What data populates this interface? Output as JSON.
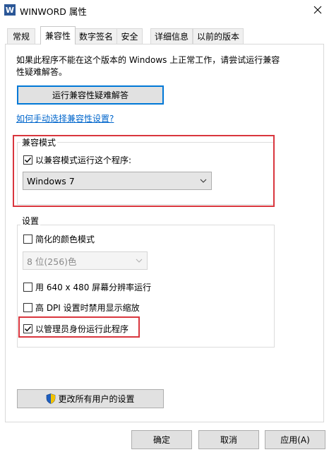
{
  "window": {
    "app_icon_letter": "W",
    "title": "WINWORD 属性"
  },
  "tabs": [
    {
      "label": "常规"
    },
    {
      "label": "兼容性"
    },
    {
      "label": "数字签名"
    },
    {
      "label": "安全"
    },
    {
      "label": "详细信息"
    },
    {
      "label": "以前的版本"
    }
  ],
  "active_tab": "兼容性",
  "intro": {
    "text": "如果此程序不能在这个版本的 Windows 上正常工作，请尝试运行兼容性疑难解答。"
  },
  "troubleshoot_button": {
    "label": "运行兼容性疑难解答"
  },
  "manual_link": {
    "label": "如何手动选择兼容性设置?"
  },
  "compat_mode": {
    "group_label": "兼容模式",
    "checkbox_label": "以兼容模式运行这个程序:",
    "checked": true,
    "os_select": {
      "value": "Windows 7"
    }
  },
  "settings": {
    "group_label": "设置",
    "reduced_color": {
      "label": "简化的颜色模式",
      "checked": false
    },
    "color_select": {
      "value": "8 位(256)色",
      "disabled": true
    },
    "res_640": {
      "label": "用 640 x 480 屏幕分辨率运行",
      "checked": false
    },
    "high_dpi": {
      "label": "高 DPI 设置时禁用显示缩放",
      "checked": false
    },
    "run_as_admin": {
      "label": "以管理员身份运行此程序",
      "checked": true
    }
  },
  "all_users_button": {
    "label": "更改所有用户的设置",
    "icon": "shield-icon"
  },
  "footer": {
    "ok_label": "确定",
    "cancel_label": "取消",
    "apply_label": "应用(A)"
  },
  "colors": {
    "highlight_red": "#d9363e",
    "focus_blue": "#0078d7",
    "link_blue": "#0066cc"
  }
}
